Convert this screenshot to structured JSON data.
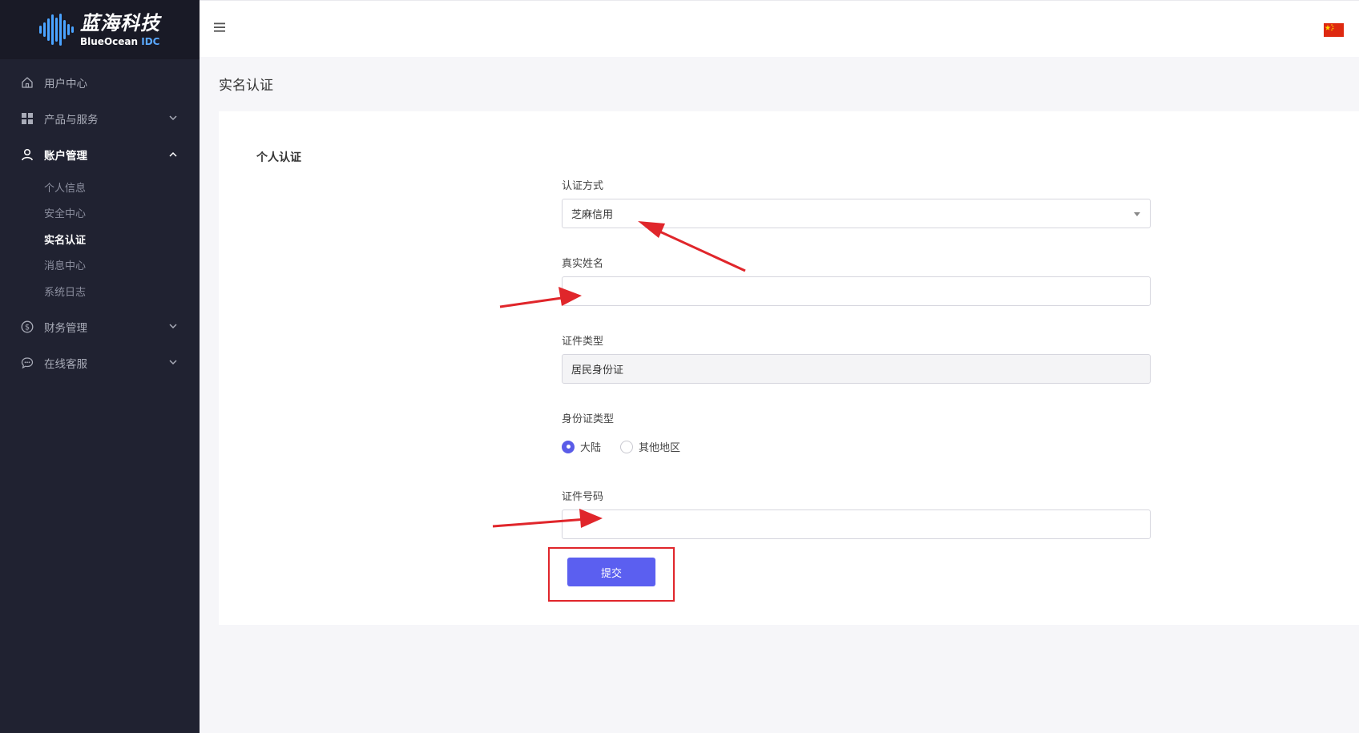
{
  "logo": {
    "cn": "蓝海科技",
    "en_main": "BlueOcean",
    "en_accent": "IDC"
  },
  "sidebar": {
    "items": [
      {
        "label": "用户中心",
        "icon": "home-icon",
        "expanded": false
      },
      {
        "label": "产品与服务",
        "icon": "grid-icon",
        "expanded": false
      },
      {
        "label": "账户管理",
        "icon": "user-icon",
        "expanded": true,
        "subitems": [
          {
            "label": "个人信息",
            "active": false
          },
          {
            "label": "安全中心",
            "active": false
          },
          {
            "label": "实名认证",
            "active": true
          },
          {
            "label": "消息中心",
            "active": false
          },
          {
            "label": "系统日志",
            "active": false
          }
        ]
      },
      {
        "label": "财务管理",
        "icon": "dollar-icon",
        "expanded": false
      },
      {
        "label": "在线客服",
        "icon": "chat-icon",
        "expanded": false
      }
    ]
  },
  "topbar": {
    "menu_icon": "hamburger-icon",
    "language_flag": "china-flag-icon"
  },
  "page": {
    "title": "实名认证"
  },
  "form": {
    "section_title": "个人认证",
    "auth_method": {
      "label": "认证方式",
      "value": "芝麻信用"
    },
    "real_name": {
      "label": "真实姓名",
      "value": ""
    },
    "id_type": {
      "label": "证件类型",
      "value": "居民身份证"
    },
    "id_region": {
      "label": "身份证类型",
      "options": [
        "大陆",
        "其他地区"
      ],
      "selected": "大陆"
    },
    "id_number": {
      "label": "证件号码",
      "value": ""
    },
    "submit_label": "提交"
  },
  "colors": {
    "sidebar_bg": "#202231",
    "accent": "#5b5ff0",
    "annotation_red": "#e0262b",
    "logo_blue": "#4aa3ff"
  }
}
